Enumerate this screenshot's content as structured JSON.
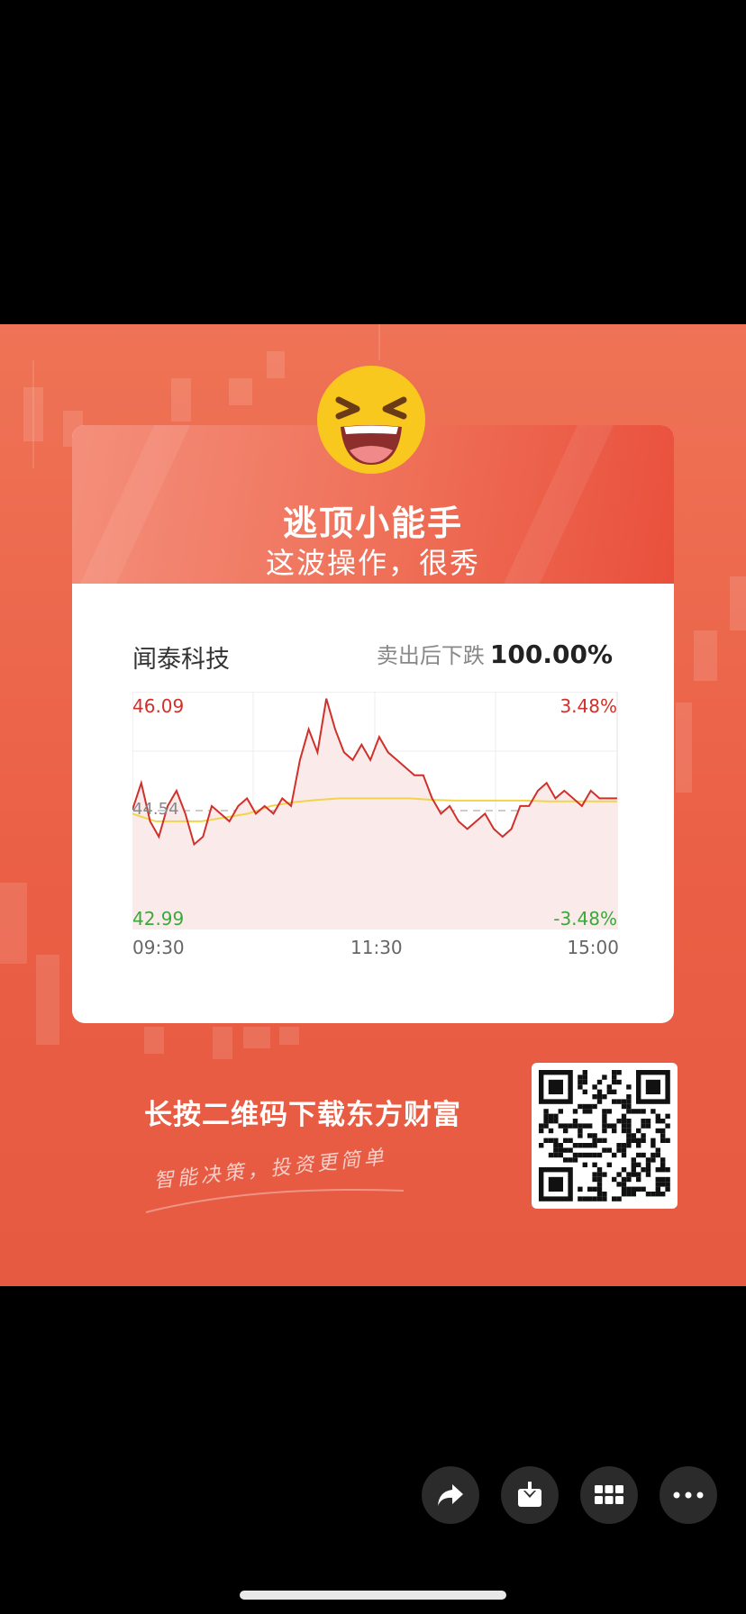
{
  "card": {
    "title": "逃顶小能手",
    "subtitle": "这波操作，很秀",
    "stock_name": "闻泰科技",
    "result_label": "卖出后下跌",
    "result_value": "100.00%"
  },
  "chart": {
    "price_high": "46.09",
    "price_low": "42.99",
    "price_mid": "44.54",
    "pct_high": "3.48%",
    "pct_low": "-3.48%",
    "time_start": "09:30",
    "time_mid": "11:30",
    "time_end": "15:00"
  },
  "chart_data": {
    "type": "line",
    "x_labels": [
      "09:30",
      "11:30",
      "15:00"
    ],
    "ylim": [
      42.99,
      46.09
    ],
    "reference_price": 44.54,
    "series": [
      {
        "values": [
          44.55,
          44.9,
          44.4,
          44.2,
          44.6,
          44.8,
          44.5,
          44.1,
          44.2,
          44.6,
          44.5,
          44.4,
          44.6,
          44.7,
          44.5,
          44.6,
          44.5,
          44.7,
          44.6,
          45.2,
          45.6,
          45.3,
          46.0,
          45.6,
          45.3,
          45.2,
          45.4,
          45.2,
          45.5,
          45.3,
          45.2,
          45.1,
          45.0,
          45.0,
          44.7,
          44.5,
          44.6,
          44.4,
          44.3,
          44.4,
          44.5,
          44.3,
          44.2,
          44.3,
          44.6,
          44.6,
          44.8,
          44.9,
          44.7,
          44.8,
          44.7,
          44.6,
          44.8,
          44.7,
          44.7,
          44.7
        ]
      },
      {
        "values": [
          44.5,
          44.4,
          44.4,
          44.4,
          44.45,
          44.5,
          44.6,
          44.65,
          44.68,
          44.7,
          44.7,
          44.7,
          44.7,
          44.68,
          44.67,
          44.67,
          44.67,
          44.67,
          44.66,
          44.66,
          44.66,
          44.66
        ]
      }
    ],
    "colors": {
      "price": "#d0302a",
      "average": "#f2d44a",
      "fill": "#fbeaea"
    }
  },
  "footer": {
    "download_text": "长按二维码下载东方财富",
    "slogan": "智能决策，投资更简单"
  },
  "toolbar": {
    "icons": [
      "share-icon",
      "download-icon",
      "grid-icon",
      "more-icon"
    ]
  }
}
